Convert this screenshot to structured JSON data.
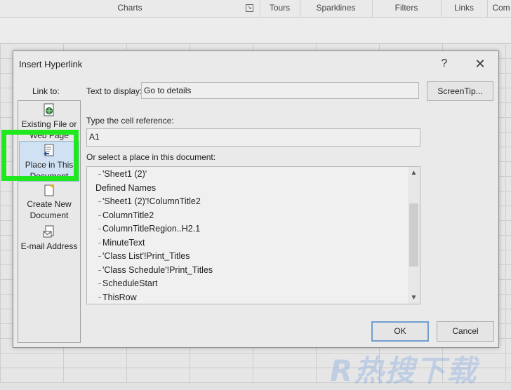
{
  "ribbon": {
    "groups": [
      "Charts",
      "Tours",
      "Sparklines",
      "Filters",
      "Links",
      "Com"
    ]
  },
  "dialog": {
    "title": "Insert Hyperlink",
    "help_label": "?",
    "close_label": "✕",
    "link_to_label": "Link to:",
    "link_options": {
      "existing": [
        "Existing File or",
        "Web Page"
      ],
      "place": [
        "Place in This",
        "Document"
      ],
      "new": [
        "Create New",
        "Document"
      ],
      "email": [
        "E-mail Address"
      ]
    },
    "text_to_display_label": "Text to display:",
    "text_to_display_value": "Go to details",
    "screentip_label": "ScreenTip...",
    "cell_ref_label": "Type the cell reference:",
    "cell_ref_value": "A1",
    "place_label": "Or select a place in this document:",
    "tree": [
      {
        "label": "'Sheet1 (2)'",
        "level": 1
      },
      {
        "label": "Defined Names",
        "level": 0
      },
      {
        "label": "'Sheet1 (2)'!ColumnTitle2",
        "level": 1
      },
      {
        "label": "ColumnTitle2",
        "level": 1
      },
      {
        "label": "ColumnTitleRegion..H2.1",
        "level": 1
      },
      {
        "label": "MinuteText",
        "level": 1
      },
      {
        "label": "'Class List'!Print_Titles",
        "level": 1
      },
      {
        "label": "'Class Schedule'!Print_Titles",
        "level": 1
      },
      {
        "label": "ScheduleStart",
        "level": 1
      },
      {
        "label": "ThisRow",
        "level": 1
      }
    ],
    "ok_label": "OK",
    "cancel_label": "Cancel"
  },
  "colors": {
    "highlight": "#1fe81f",
    "selected_bg": "#cfe1f2",
    "ok_border": "#6f9fd0"
  },
  "watermark": "R热搜下载"
}
